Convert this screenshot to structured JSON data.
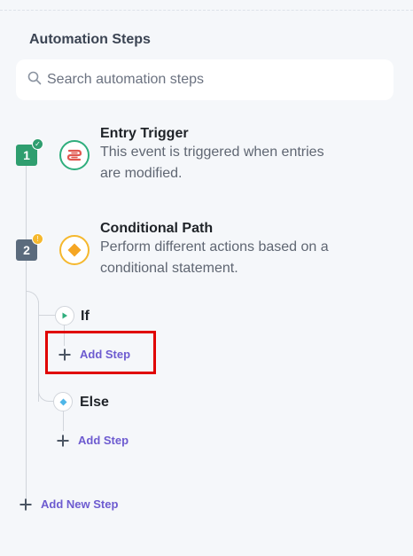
{
  "panel": {
    "title": "Automation Steps"
  },
  "search": {
    "placeholder": "Search automation steps",
    "value": ""
  },
  "steps": [
    {
      "number": "1",
      "title": "Entry Trigger",
      "description": "This event is triggered when entries are modified.",
      "icon": "entry-trigger-icon",
      "status": "completed",
      "status_color": "#2f9e6f"
    },
    {
      "number": "2",
      "title": "Conditional Path",
      "description": "Perform different actions based on a conditional statement.",
      "icon": "conditional-diamond-icon",
      "status": "warning",
      "status_color": "#f5b82e"
    }
  ],
  "branches": [
    {
      "label": "If",
      "icon": "play-icon",
      "add_step_label": "Add Step"
    },
    {
      "label": "Else",
      "icon": "diamond-icon",
      "add_step_label": "Add Step"
    }
  ],
  "add_new_step_label": "Add New Step",
  "colors": {
    "accent": "#6d5bd0",
    "trigger": "#2fae7d",
    "conditional": "#f5b82e",
    "highlight": "#e00000"
  }
}
